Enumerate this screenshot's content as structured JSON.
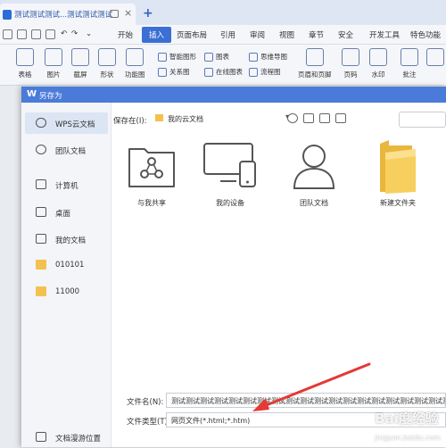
{
  "tab": {
    "title": "测试测试测试...测试测试测试"
  },
  "menu": {
    "items": [
      "开始",
      "插入",
      "页面布局",
      "引用",
      "审阅",
      "视图",
      "章节",
      "安全",
      "开发工具",
      "特色功能"
    ]
  },
  "ribbon": {
    "big": [
      "表格",
      "图片",
      "截屏",
      "形状",
      "功能图",
      "页眉和页脚",
      "页码",
      "水印",
      "批注"
    ],
    "small": [
      "智能图形",
      "图表",
      "思维导图",
      "关系图",
      "在线图表",
      "流程图"
    ]
  },
  "dialog": {
    "title": "另存为",
    "sidebar": [
      "WPS云文档",
      "团队文档",
      "计算机",
      "桌面",
      "我的文档",
      "010101",
      "11000",
      "文档漫游位置"
    ],
    "save_location_label": "保存在(I):",
    "save_location_value": "我的云文档",
    "icons": [
      "与我共享",
      "我的设备",
      "团队文档",
      "新建文件夹"
    ],
    "filename_label": "文件名(N):",
    "filename_value": "测试测试测试测试测试测试测试测试测试测试测试测试测试测试测试测试测试测试测试测试",
    "filetype_label": "文件类型(T):",
    "filetype_value": "网页文件(*.html;*.htm)"
  },
  "watermark": "Bai度经验",
  "watermark_url": "jingyan.baidu.com",
  "colors": {
    "accent": "#3b6fd4",
    "dialog_title": "#4a7bd8",
    "arrow": "#e53935",
    "folder": "#f2c14e"
  }
}
